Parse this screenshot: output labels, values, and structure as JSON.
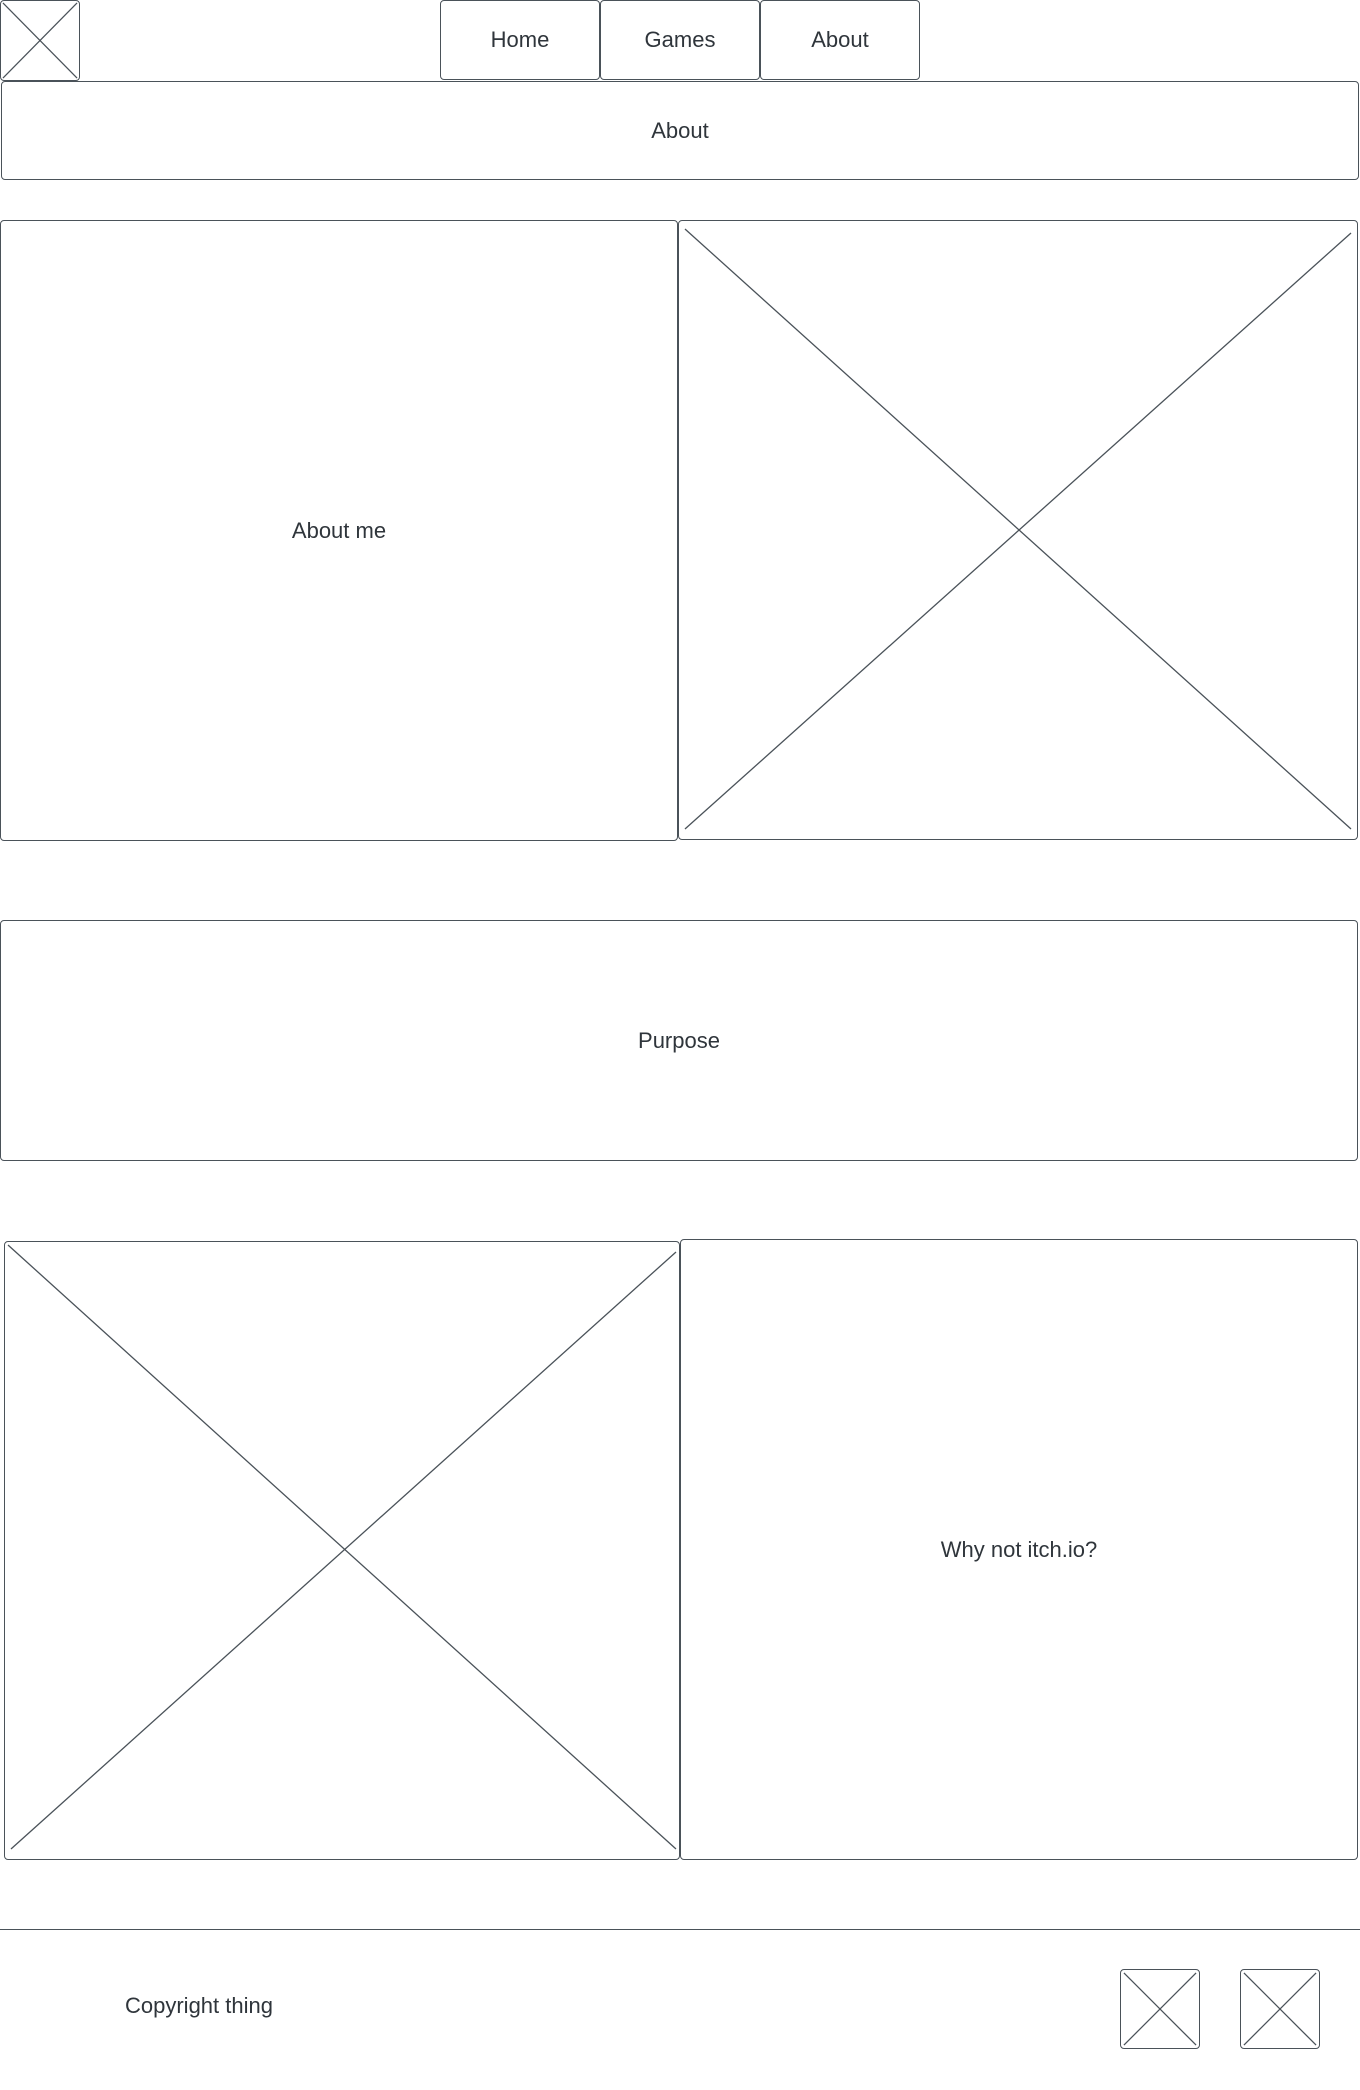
{
  "header": {
    "logo_icon": "image-placeholder-icon",
    "nav": [
      {
        "label": "Home"
      },
      {
        "label": "Games"
      },
      {
        "label": "About"
      }
    ]
  },
  "banner": {
    "title": "About"
  },
  "sections": {
    "about_me": {
      "label": "About me",
      "image_icon": "image-placeholder-icon"
    },
    "purpose": {
      "label": "Purpose"
    },
    "why_not": {
      "label": "Why not itch.io?",
      "image_icon": "image-placeholder-icon"
    }
  },
  "footer": {
    "copyright": "Copyright thing",
    "social_icons": [
      "image-placeholder-icon",
      "image-placeholder-icon"
    ]
  },
  "colors": {
    "stroke": "#4a5259",
    "text": "#2f353b",
    "background": "#ffffff"
  }
}
